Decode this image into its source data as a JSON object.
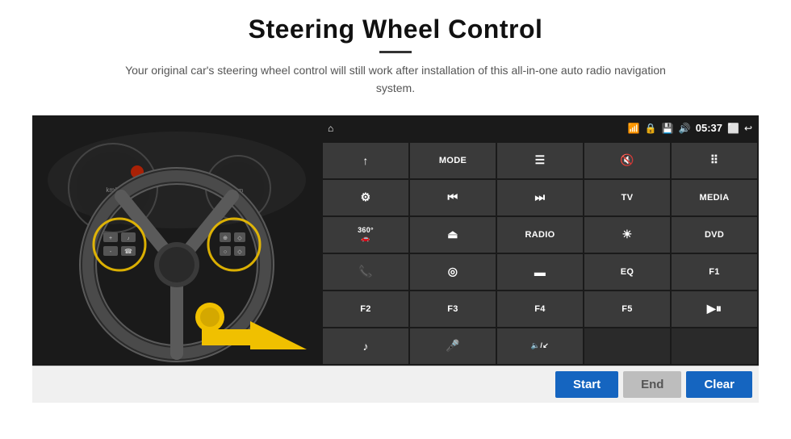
{
  "header": {
    "title": "Steering Wheel Control",
    "subtitle": "Your original car's steering wheel control will still work after installation of this all-in-one auto radio navigation system."
  },
  "status_bar": {
    "wifi_icon": "wifi",
    "lock_icon": "lock",
    "sd_icon": "sd",
    "bt_icon": "bt",
    "time": "05:37",
    "screen_icon": "screen",
    "back_icon": "back"
  },
  "buttons": [
    {
      "id": "nav",
      "type": "icon",
      "label": "↑",
      "symbol": "nav"
    },
    {
      "id": "mode",
      "type": "text",
      "label": "MODE"
    },
    {
      "id": "list",
      "type": "icon",
      "label": "≡",
      "symbol": "list"
    },
    {
      "id": "mute",
      "type": "icon",
      "label": "🔇",
      "symbol": "mute"
    },
    {
      "id": "apps",
      "type": "icon",
      "label": "⠿",
      "symbol": "apps"
    },
    {
      "id": "settings",
      "type": "icon",
      "label": "⚙",
      "symbol": "settings"
    },
    {
      "id": "prev",
      "type": "icon",
      "label": "⏮",
      "symbol": "prev"
    },
    {
      "id": "next",
      "type": "icon",
      "label": "⏭",
      "symbol": "next"
    },
    {
      "id": "tv",
      "type": "text",
      "label": "TV"
    },
    {
      "id": "media",
      "type": "text",
      "label": "MEDIA"
    },
    {
      "id": "360",
      "type": "icon",
      "label": "360°",
      "symbol": "360"
    },
    {
      "id": "eject",
      "type": "icon",
      "label": "⏏",
      "symbol": "eject"
    },
    {
      "id": "radio",
      "type": "text",
      "label": "RADIO"
    },
    {
      "id": "bright",
      "type": "icon",
      "label": "☼",
      "symbol": "bright"
    },
    {
      "id": "dvd",
      "type": "text",
      "label": "DVD"
    },
    {
      "id": "phone",
      "type": "icon",
      "label": "📞",
      "symbol": "phone"
    },
    {
      "id": "nav2",
      "type": "icon",
      "label": "◎",
      "symbol": "nav2"
    },
    {
      "id": "screen",
      "type": "icon",
      "label": "▬",
      "symbol": "screen"
    },
    {
      "id": "eq",
      "type": "text",
      "label": "EQ"
    },
    {
      "id": "f1",
      "type": "text",
      "label": "F1"
    },
    {
      "id": "f2",
      "type": "text",
      "label": "F2"
    },
    {
      "id": "f3",
      "type": "text",
      "label": "F3"
    },
    {
      "id": "f4",
      "type": "text",
      "label": "F4"
    },
    {
      "id": "f5",
      "type": "text",
      "label": "F5"
    },
    {
      "id": "playpause",
      "type": "icon",
      "label": "▶⏸",
      "symbol": "playpause"
    },
    {
      "id": "music",
      "type": "icon",
      "label": "♪",
      "symbol": "music"
    },
    {
      "id": "mic",
      "type": "icon",
      "label": "🎤",
      "symbol": "mic"
    },
    {
      "id": "vol",
      "type": "icon",
      "label": "🔈/↙",
      "symbol": "vol"
    },
    {
      "id": "empty1",
      "type": "empty",
      "label": ""
    },
    {
      "id": "empty2",
      "type": "empty",
      "label": ""
    }
  ],
  "action_buttons": {
    "start": "Start",
    "end": "End",
    "clear": "Clear"
  },
  "colors": {
    "panel_bg": "#2a2a2a",
    "btn_bg": "#3a3a3a",
    "status_bg": "#1a1a1a",
    "action_bar_bg": "#f0f0f0",
    "btn_primary": "#1565c0",
    "btn_disabled": "#bdbdbd"
  }
}
